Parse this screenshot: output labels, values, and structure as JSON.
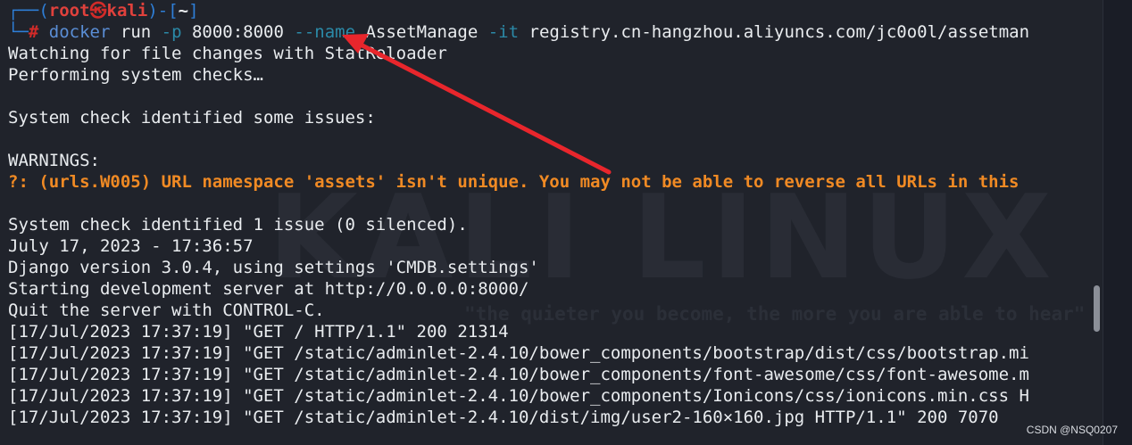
{
  "prompt": {
    "corner": "┌──(",
    "user": "root",
    "symbol": "㉿",
    "host": "kali",
    "close": ")-[",
    "dir": "~",
    "dir_close": "]",
    "corner2": "└─",
    "hash": "#"
  },
  "command": {
    "docker": "docker",
    "run": " run ",
    "p_flag": "-p",
    "ports": " 8000:8000 ",
    "name_flag": "--name",
    "name": " AssetManage ",
    "it_flag": "-it",
    "image": " registry.cn-hangzhou.aliyuncs.com/jc0o0l/assetman"
  },
  "output": {
    "l1": "Watching for file changes with StatReloader",
    "l2": "Performing system checks…",
    "l3": "",
    "l4": "System check identified some issues:",
    "l5": "",
    "l6": "WARNINGS:",
    "l7": "?: (urls.W005) URL namespace 'assets' isn't unique. You may not be able to reverse all URLs in this",
    "l8": "",
    "l9": "System check identified 1 issue (0 silenced).",
    "l10": "July 17, 2023 - 17:36:57",
    "l11": "Django version 3.0.4, using settings 'CMDB.settings'",
    "l12": "Starting development server at http://0.0.0.0:8000/",
    "l13": "Quit the server with CONTROL-C.",
    "l14": "[17/Jul/2023 17:37:19] \"GET / HTTP/1.1\" 200 21314",
    "l15": "[17/Jul/2023 17:37:19] \"GET /static/adminlet-2.4.10/bower_components/bootstrap/dist/css/bootstrap.mi",
    "l16": "[17/Jul/2023 17:37:19] \"GET /static/adminlet-2.4.10/bower_components/font-awesome/css/font-awesome.m",
    "l17": "[17/Jul/2023 17:37:19] \"GET /static/adminlet-2.4.10/bower_components/Ionicons/css/ionicons.min.css H",
    "l18": "[17/Jul/2023 17:37:19] \"GET /static/adminlet-2.4.10/dist/img/user2-160×160.jpg HTTP/1.1\" 200 7070"
  },
  "watermark": {
    "logo": "KALI LINUX",
    "quote": "\"the quieter you become, the more you are able to hear\""
  },
  "credit": "CSDN @NSQ0207",
  "colors": {
    "background": "#20232b",
    "prompt_red": "#e0413c",
    "prompt_blue": "#2e7fd8",
    "warning_orange": "#f08a24",
    "annotation_arrow": "#e8262c"
  }
}
